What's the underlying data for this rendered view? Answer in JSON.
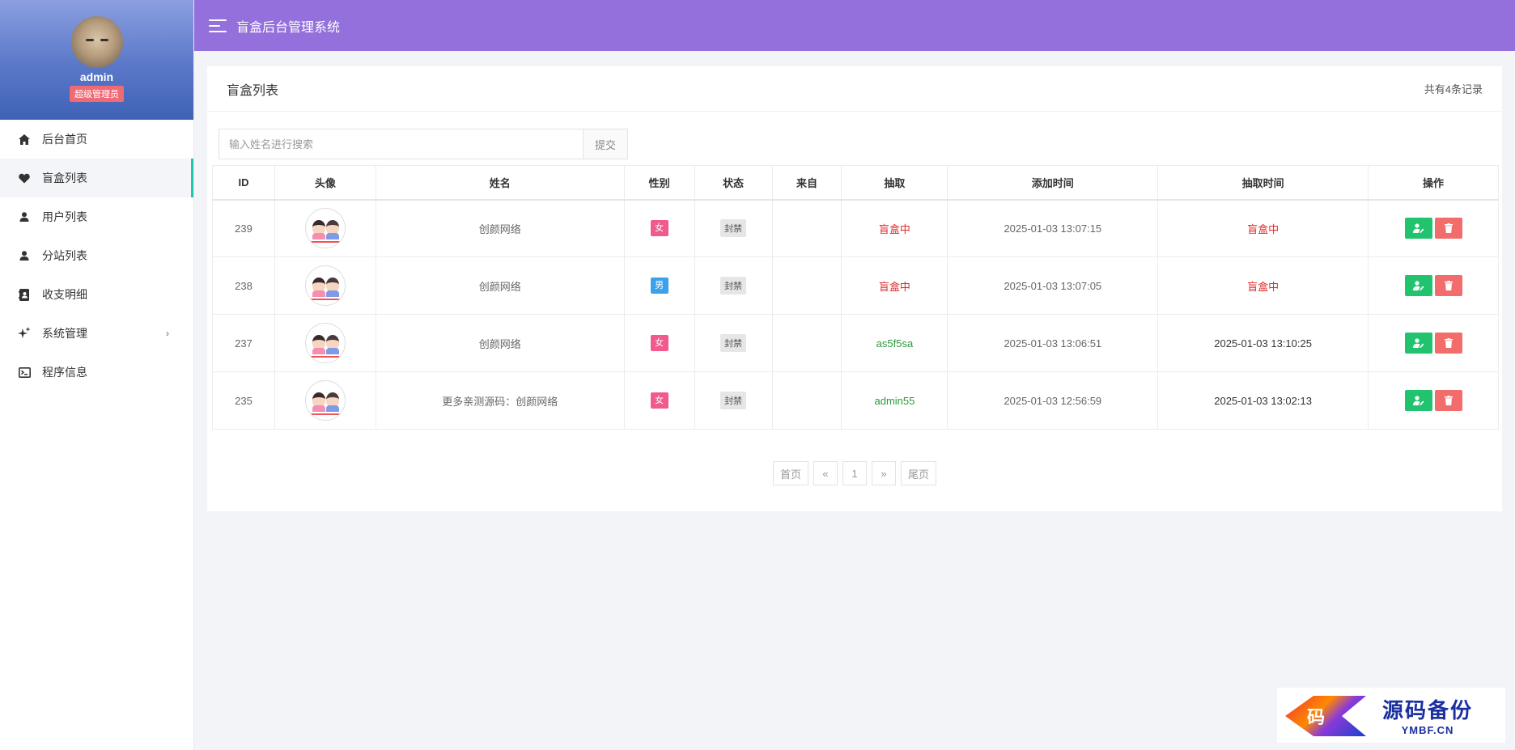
{
  "app": {
    "title": "盲盒后台管理系统"
  },
  "profile": {
    "name": "admin",
    "role": "超级管理员"
  },
  "menu": [
    {
      "label": "后台首页",
      "icon": "home-icon",
      "active": false
    },
    {
      "label": "盲盒列表",
      "icon": "heart-icon",
      "active": true
    },
    {
      "label": "用户列表",
      "icon": "user-icon",
      "active": false
    },
    {
      "label": "分站列表",
      "icon": "user-icon",
      "active": false
    },
    {
      "label": "收支明细",
      "icon": "ledger-icon",
      "active": false
    },
    {
      "label": "系统管理",
      "icon": "sparkle-icon",
      "active": false,
      "chevron": "›"
    },
    {
      "label": "程序信息",
      "icon": "terminal-icon",
      "active": false
    }
  ],
  "card": {
    "title": "盲盒列表",
    "count": "共有4条记录"
  },
  "search": {
    "placeholder": "输入姓名进行搜索",
    "submit": "提交"
  },
  "table": {
    "headers": [
      "ID",
      "头像",
      "姓名",
      "性别",
      "状态",
      "来自",
      "抽取",
      "添加时间",
      "抽取时间",
      "操作"
    ],
    "rows": [
      {
        "id": "239",
        "name": "创颜网络",
        "gender": "女",
        "status": "封禁",
        "from": "",
        "draw": "盲盒中",
        "added": "2025-01-03 13:07:15",
        "drawn": "盲盒中"
      },
      {
        "id": "238",
        "name": "创颜网络",
        "gender": "男",
        "status": "封禁",
        "from": "",
        "draw": "盲盒中",
        "added": "2025-01-03 13:07:05",
        "drawn": "盲盒中"
      },
      {
        "id": "237",
        "name": "创颜网络",
        "gender": "女",
        "status": "封禁",
        "from": "",
        "draw": "as5f5sa",
        "added": "2025-01-03 13:06:51",
        "drawn": "2025-01-03 13:10:25"
      },
      {
        "id": "235",
        "name": "更多亲测源码：创颜网络",
        "gender": "女",
        "status": "封禁",
        "from": "",
        "draw": "admin55",
        "added": "2025-01-03 12:56:59",
        "drawn": "2025-01-03 13:02:13"
      }
    ]
  },
  "pager": {
    "first": "首页",
    "prev": "«",
    "page": "1",
    "next": "»",
    "last": "尾页"
  },
  "watermark": {
    "logo_char": "码",
    "title": "源码备份",
    "domain": "YMBF.CN"
  },
  "colors": {
    "topbar": "#9370db",
    "active_bar": "#1fc8a8",
    "female": "#f05a8c",
    "male": "#3ba2ea",
    "edit": "#21c36e",
    "delete": "#f36c6c",
    "drawing": "#e02a2a",
    "drawn_code": "#2a9a3a"
  }
}
